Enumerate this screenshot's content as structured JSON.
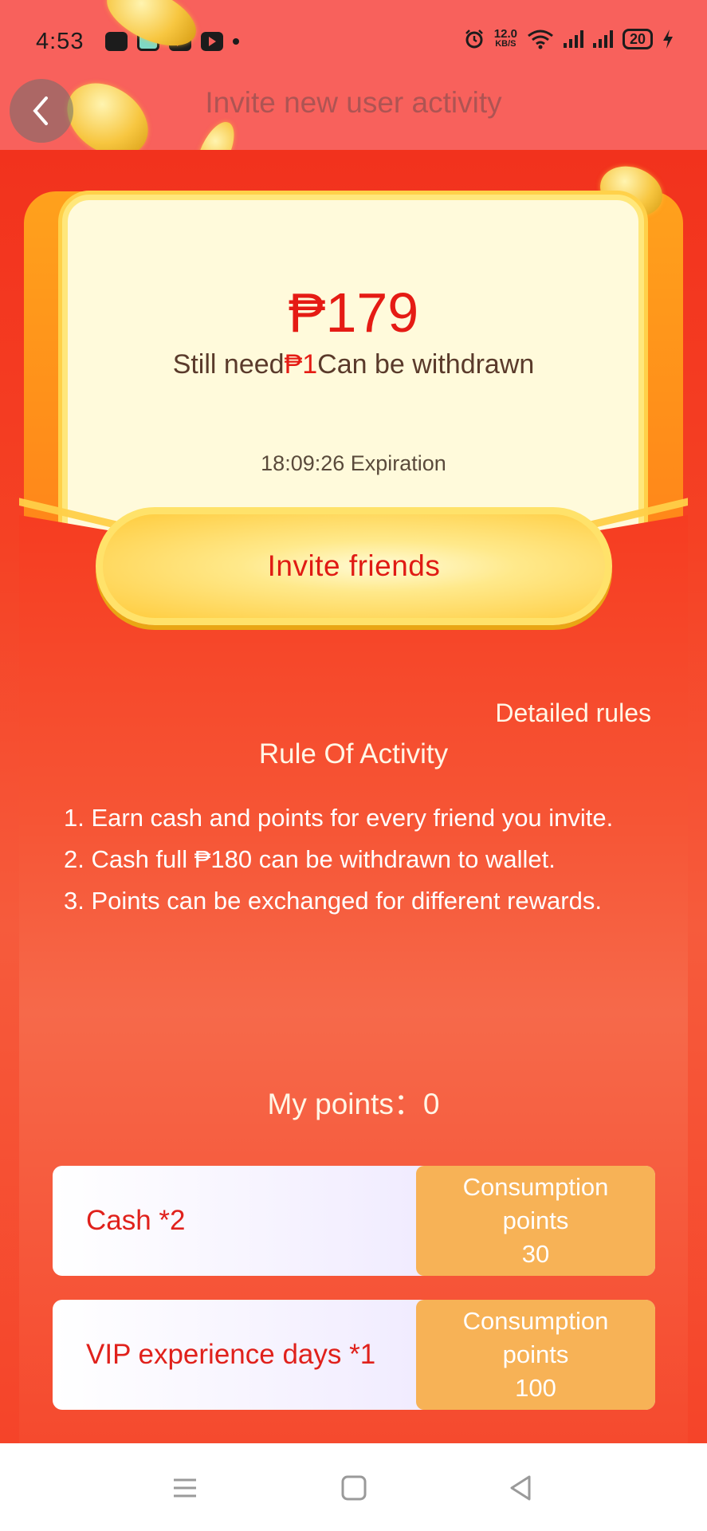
{
  "status_bar": {
    "time": "4:53",
    "net_speed_value": "12.0",
    "net_speed_unit": "KB/S",
    "battery": "20"
  },
  "header": {
    "title": "Invite new user activity"
  },
  "card": {
    "amount": "₱179",
    "still_need_prefix": "Still need",
    "still_need_amount": "₱1",
    "still_need_suffix": "Can be withdrawn",
    "expiration": "18:09:26 Expiration"
  },
  "invite_button": {
    "label": "Invite friends"
  },
  "rules": {
    "detailed_link": "Detailed rules",
    "title": "Rule Of Activity",
    "items": [
      "1. Earn cash and points for every friend you invite.",
      "2. Cash full ₱180 can be withdrawn to wallet.",
      "3. Points can be exchanged for different rewards."
    ]
  },
  "points": {
    "label": "My points：0"
  },
  "rewards": [
    {
      "name": "Cash *2",
      "cost_line1": "Consumption",
      "cost_line2": "points",
      "cost_value": "30"
    },
    {
      "name": "VIP experience days *1",
      "cost_line1": "Consumption",
      "cost_line2": "points",
      "cost_value": "100"
    }
  ],
  "colors": {
    "header_bg": "#f8615c",
    "main_red": "#f54124",
    "accent_gold": "#ffcb3c",
    "text_red": "#e51b14",
    "cost_orange": "#f7b256"
  }
}
